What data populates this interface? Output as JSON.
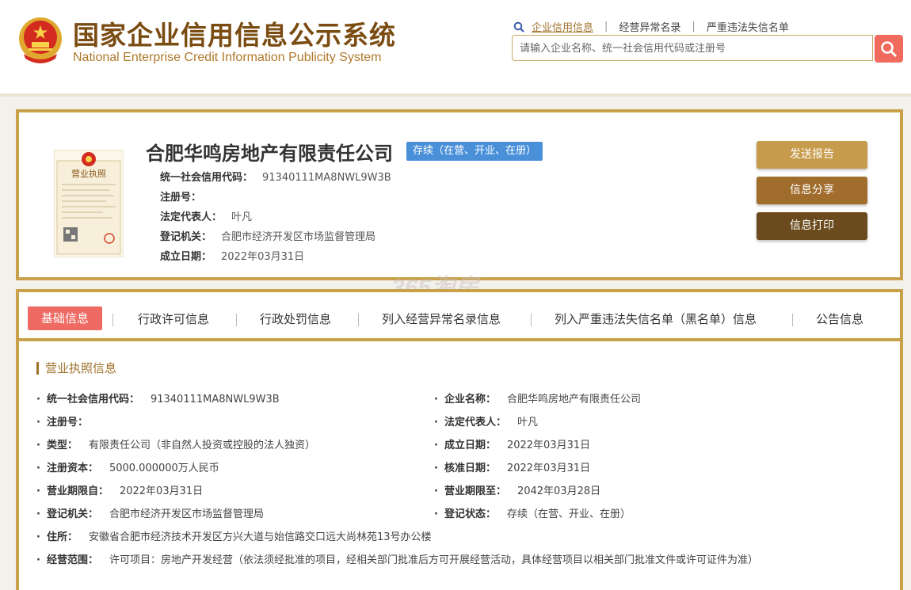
{
  "header": {
    "title_cn": "国家企业信用信息公示系统",
    "title_en": "National Enterprise Credit Information Publicity System",
    "links": [
      "企业信用信息",
      "经营异常名录",
      "严重违法失信名单"
    ],
    "search_placeholder": "请输入企业名称、统一社会信用代码或注册号"
  },
  "company": {
    "name": "合肥华鸣房地产有限责任公司",
    "status": "存续（在营、开业、在册）",
    "license_title": "营业执照",
    "fields": [
      {
        "label": "统一社会信用代码：",
        "value": "91340111MA8NWL9W3B"
      },
      {
        "label": "注册号：",
        "value": ""
      },
      {
        "label": "法定代表人：",
        "value": "叶凡"
      },
      {
        "label": "登记机关：",
        "value": "合肥市经济开发区市场监督管理局"
      },
      {
        "label": "成立日期：",
        "value": "2022年03月31日"
      }
    ],
    "buttons": {
      "send": "发送报告",
      "share": "信息分享",
      "print": "信息打印"
    }
  },
  "watermark": "365淘房",
  "tabs": [
    "基础信息",
    "行政许可信息",
    "行政处罚信息",
    "列入经营异常名录信息",
    "列入严重违法失信名单（黑名单）信息",
    "公告信息"
  ],
  "basic_info": {
    "section_title": "营业执照信息",
    "left": [
      {
        "label": "统一社会信用代码：",
        "value": "91340111MA8NWL9W3B"
      },
      {
        "label": "注册号：",
        "value": ""
      },
      {
        "label": "类型：",
        "value": "有限责任公司（非自然人投资或控股的法人独资）"
      },
      {
        "label": "注册资本：",
        "value": "5000.000000万人民币"
      },
      {
        "label": "营业期限自：",
        "value": "2022年03月31日"
      },
      {
        "label": "登记机关：",
        "value": "合肥市经济开发区市场监督管理局"
      },
      {
        "label": "住所：",
        "value": "安徽省合肥市经济技术开发区方兴大道与始信路交口远大尚林苑13号办公楼"
      },
      {
        "label": "经营范围：",
        "value": "许可项目：房地产开发经营（依法须经批准的项目，经相关部门批准后方可开展经营活动，具体经营项目以相关部门批准文件或许可证件为准）"
      }
    ],
    "right": [
      {
        "label": "企业名称：",
        "value": "合肥华鸣房地产有限责任公司"
      },
      {
        "label": "法定代表人：",
        "value": "叶凡"
      },
      {
        "label": "成立日期：",
        "value": "2022年03月31日"
      },
      {
        "label": "核准日期：",
        "value": "2022年03月31日"
      },
      {
        "label": "营业期限至：",
        "value": "2042年03月28日"
      },
      {
        "label": "登记状态：",
        "value": "存续（在营、开业、在册）"
      }
    ]
  }
}
